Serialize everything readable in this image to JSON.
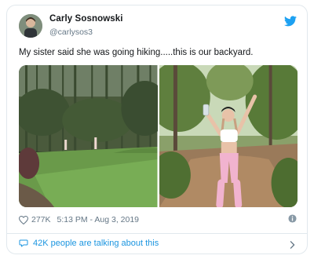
{
  "tweet": {
    "author_name": "Carly Sosnowski",
    "author_handle": "@carlysos3",
    "text": "My sister said she was going hiking.....this is our backyard.",
    "likes": "277K",
    "timestamp": "5:13 PM - Aug 3, 2019",
    "talking_about": "42K people are talking about this"
  },
  "icons": {
    "brand": "twitter-bird-icon",
    "like": "heart-icon",
    "info": "info-icon",
    "reply": "speech-bubble-icon",
    "more": "chevron-right-icon"
  },
  "colors": {
    "accent": "#1da1f2",
    "link": "#1b95e0",
    "muted": "#657786",
    "border": "#e1e8ed"
  }
}
